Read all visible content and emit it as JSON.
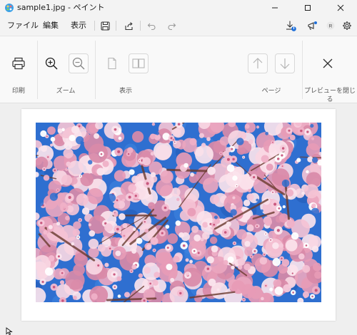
{
  "window": {
    "title": "sample1.jpg - ペイント",
    "controls": [
      "minimize",
      "maximize",
      "close"
    ]
  },
  "menu": {
    "items": [
      "ファイル",
      "編集",
      "表示"
    ],
    "toolbar_icons": [
      "save-icon",
      "share-icon",
      "undo-icon",
      "redo-icon"
    ],
    "right_icons": [
      "download-icon",
      "announcement-icon",
      "account-icon",
      "settings-icon"
    ],
    "download_badge": "i"
  },
  "ribbon": {
    "groups": {
      "print": "印刷",
      "zoom": "ズーム",
      "view": "表示",
      "page": "ページ",
      "close": "プレビューを閉じる"
    }
  },
  "preview": {
    "image_alt": "cherry blossoms",
    "colors": {
      "sky": "#2f6fd0",
      "blossom": "#f2b8cc",
      "branch": "#6a3a2e"
    }
  }
}
